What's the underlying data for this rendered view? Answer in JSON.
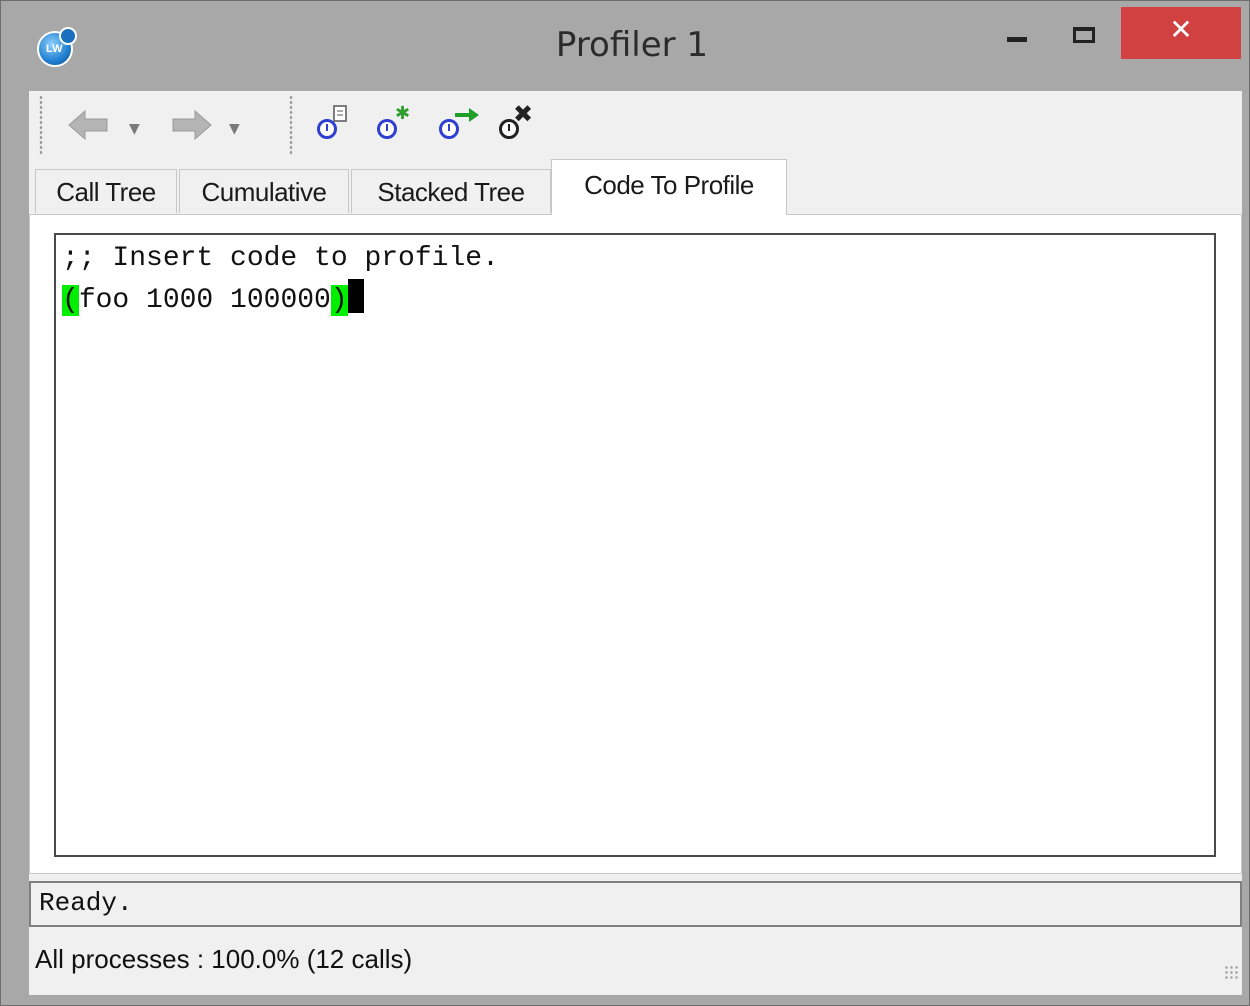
{
  "window": {
    "title": "Profiler 1",
    "app_icon_text": "LW",
    "close_glyph": "✕"
  },
  "toolbar": {
    "back_icon": "arrow-left-icon",
    "forward_icon": "arrow-right-icon",
    "dropdown_glyph": "▼",
    "profile_buttons": [
      "profile-report-icon",
      "profile-settings-icon",
      "profile-run-icon",
      "profile-clear-icon"
    ]
  },
  "tabs": [
    {
      "label": "Call Tree",
      "active": false
    },
    {
      "label": "Cumulative",
      "active": false
    },
    {
      "label": "Stacked Tree",
      "active": false
    },
    {
      "label": "Code To Profile",
      "active": true
    }
  ],
  "editor": {
    "line1": ";; Insert code to profile.",
    "line2_open_paren": "(",
    "line2_body": "foo 1000 100000",
    "line2_close_paren": ")",
    "paren_highlight_color": "#00ef00"
  },
  "status": {
    "message": "Ready.",
    "processes": "All processes :  100.0% (12 calls)"
  },
  "colors": {
    "close_button": "#d14142",
    "clock_icon": "#2f3fd0"
  }
}
